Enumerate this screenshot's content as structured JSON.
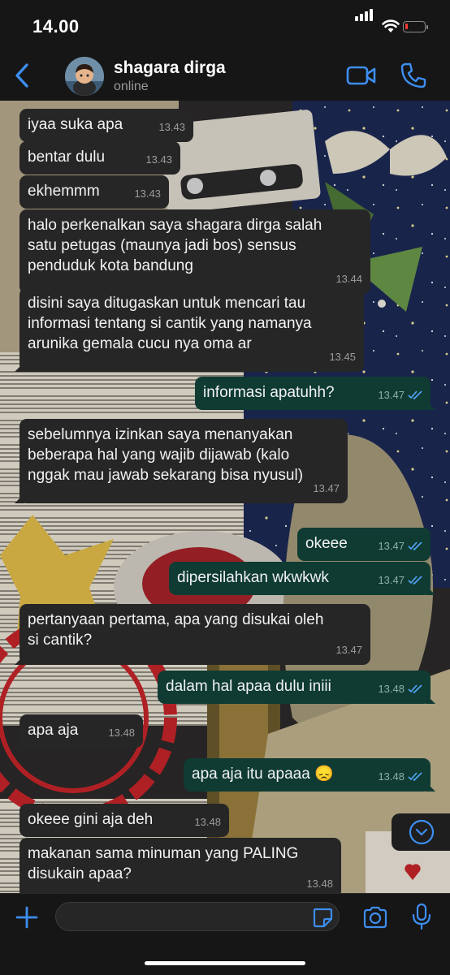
{
  "status_bar": {
    "time": "14.00"
  },
  "header": {
    "contact_name": "shagara dirga",
    "contact_status": "online",
    "icons": {
      "back": "chevron-left-icon",
      "video": "video-camera-icon",
      "call": "phone-icon"
    }
  },
  "colors": {
    "accent": "#3d8ef0",
    "incoming_bubble": "#262626",
    "outgoing_bubble": "#0f3b33",
    "read_ticks": "#53a6fa"
  },
  "messages": [
    {
      "dir": "in",
      "text": "iyaa suka apa",
      "time": "13.43"
    },
    {
      "dir": "in",
      "text": "bentar dulu",
      "time": "13.43"
    },
    {
      "dir": "in",
      "text": "ekhemmm",
      "time": "13.43"
    },
    {
      "dir": "in",
      "text": "halo perkenalkan saya shagara dirga salah\nsatu petugas (maunya jadi bos) sensus\npenduduk kota bandung",
      "time": "13.44"
    },
    {
      "dir": "in",
      "text": "disini saya ditugaskan untuk mencari tau\ninformasi tentang si cantik yang namanya\narunika gemala cucu nya oma ar",
      "time": "13.45"
    },
    {
      "dir": "out",
      "text": "informasi apatuhh?",
      "time": "13.47"
    },
    {
      "dir": "in",
      "text": "sebelumnya izinkan saya menanyakan\nbeberapa hal yang wajib dijawab (kalo\nnggak mau jawab sekarang bisa nyusul)",
      "time": "13.47"
    },
    {
      "dir": "out",
      "text": "okeee",
      "time": "13.47"
    },
    {
      "dir": "out",
      "text": "dipersilahkan wkwkwk",
      "time": "13.47"
    },
    {
      "dir": "in",
      "text": "pertanyaan pertama, apa yang disukai oleh\nsi cantik?",
      "time": "13.47"
    },
    {
      "dir": "out",
      "text": "dalam hal apaa dulu iniii",
      "time": "13.48"
    },
    {
      "dir": "in",
      "text": "apa aja",
      "time": "13.48"
    },
    {
      "dir": "out",
      "text": "apa aja itu apaaa 😞",
      "time": "13.48"
    },
    {
      "dir": "in",
      "text": "okeee gini aja deh",
      "time": "13.48"
    },
    {
      "dir": "in",
      "text": "makanan sama minuman yang PALING\ndisukain apaa?",
      "time": "13.48"
    }
  ],
  "input": {
    "placeholder": "",
    "value": ""
  },
  "input_icons": [
    "plus-icon",
    "sticker-icon",
    "camera-icon",
    "microphone-icon"
  ]
}
